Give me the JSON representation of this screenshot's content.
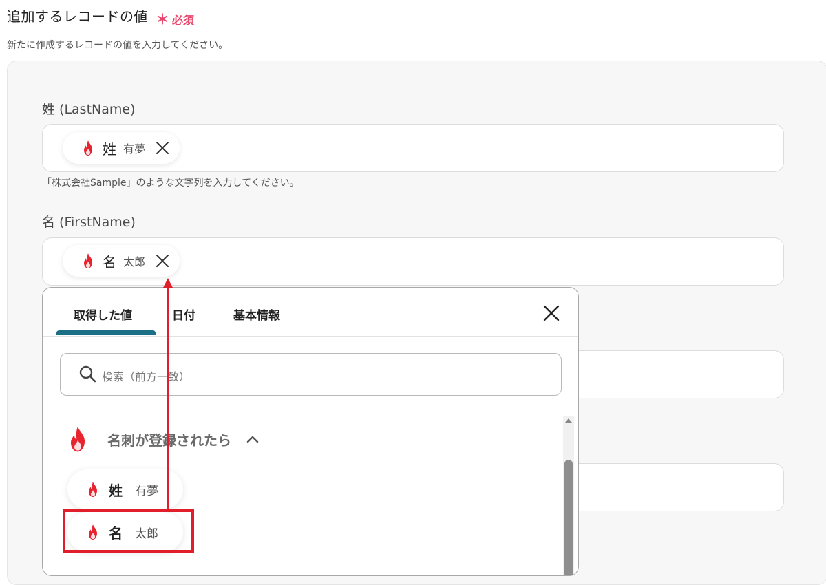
{
  "section": {
    "title": "追加するレコードの値",
    "required_mark": "＊",
    "required_label": "必須",
    "description": "新たに作成するレコードの値を入力してください。"
  },
  "fields": {
    "last_name": {
      "label": "姓 (LastName)",
      "chip": {
        "icon": "flame-icon",
        "name": "姓",
        "value": "有夢"
      },
      "hint": "「株式会社Sample」のような文字列を入力してください。"
    },
    "first_name": {
      "label": "名 (FirstName)",
      "chip": {
        "icon": "flame-icon",
        "name": "名",
        "value": "太郎"
      }
    }
  },
  "dropdown": {
    "tabs": [
      "取得した値",
      "日付",
      "基本情報"
    ],
    "active_tab": 0,
    "search_placeholder": "検索（前方一致）",
    "group": {
      "icon": "flame-icon",
      "name": "名刺が登録されたら",
      "expanded": true
    },
    "options": [
      {
        "icon": "flame-icon",
        "name": "姓",
        "value": "有夢"
      },
      {
        "icon": "flame-icon",
        "name": "名",
        "value": "太郎",
        "highlighted": true
      }
    ]
  },
  "colors": {
    "required": "#e8456b",
    "tab_underline": "#1b6f86",
    "annotation_red": "#e11f2b",
    "flame": "#e8242f"
  }
}
